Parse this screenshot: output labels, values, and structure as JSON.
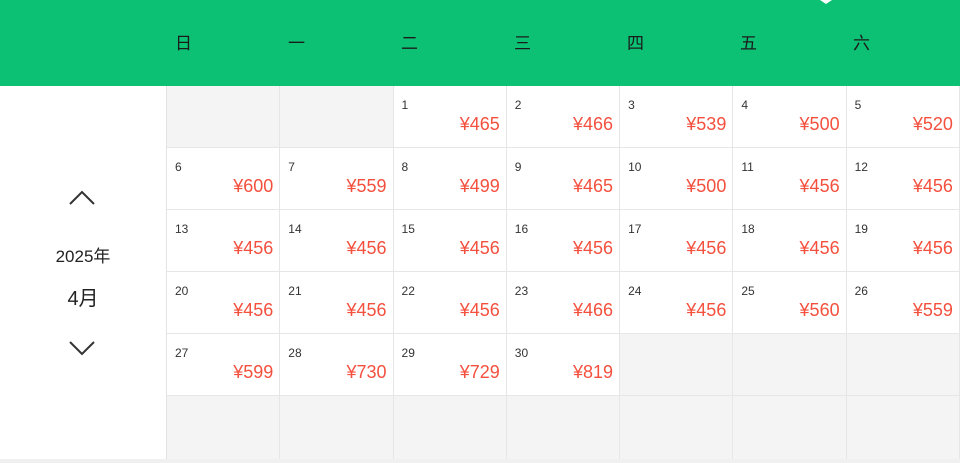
{
  "weekdays": [
    "日",
    "一",
    "二",
    "三",
    "四",
    "五",
    "六"
  ],
  "nav": {
    "year": "2025年",
    "month": "4月",
    "prev_icon": "chevron-up-icon",
    "next_icon": "chevron-down-icon"
  },
  "colors": {
    "header": "#0cc074",
    "price": "#f4503e",
    "empty_cell": "#f4f4f4"
  },
  "days": [
    {
      "day": "",
      "price": ""
    },
    {
      "day": "",
      "price": ""
    },
    {
      "day": "1",
      "price": "¥465"
    },
    {
      "day": "2",
      "price": "¥466"
    },
    {
      "day": "3",
      "price": "¥539"
    },
    {
      "day": "4",
      "price": "¥500"
    },
    {
      "day": "5",
      "price": "¥520"
    },
    {
      "day": "6",
      "price": "¥600"
    },
    {
      "day": "7",
      "price": "¥559"
    },
    {
      "day": "8",
      "price": "¥499"
    },
    {
      "day": "9",
      "price": "¥465"
    },
    {
      "day": "10",
      "price": "¥500"
    },
    {
      "day": "11",
      "price": "¥456"
    },
    {
      "day": "12",
      "price": "¥456"
    },
    {
      "day": "13",
      "price": "¥456"
    },
    {
      "day": "14",
      "price": "¥456"
    },
    {
      "day": "15",
      "price": "¥456"
    },
    {
      "day": "16",
      "price": "¥456"
    },
    {
      "day": "17",
      "price": "¥456"
    },
    {
      "day": "18",
      "price": "¥456"
    },
    {
      "day": "19",
      "price": "¥456"
    },
    {
      "day": "20",
      "price": "¥456"
    },
    {
      "day": "21",
      "price": "¥456"
    },
    {
      "day": "22",
      "price": "¥456"
    },
    {
      "day": "23",
      "price": "¥466"
    },
    {
      "day": "24",
      "price": "¥456"
    },
    {
      "day": "25",
      "price": "¥560"
    },
    {
      "day": "26",
      "price": "¥559"
    },
    {
      "day": "27",
      "price": "¥599"
    },
    {
      "day": "28",
      "price": "¥730"
    },
    {
      "day": "29",
      "price": "¥729"
    },
    {
      "day": "30",
      "price": "¥819"
    },
    {
      "day": "",
      "price": ""
    },
    {
      "day": "",
      "price": ""
    },
    {
      "day": "",
      "price": ""
    },
    {
      "day": "",
      "price": ""
    },
    {
      "day": "",
      "price": ""
    },
    {
      "day": "",
      "price": ""
    },
    {
      "day": "",
      "price": ""
    },
    {
      "day": "",
      "price": ""
    },
    {
      "day": "",
      "price": ""
    },
    {
      "day": "",
      "price": ""
    }
  ]
}
